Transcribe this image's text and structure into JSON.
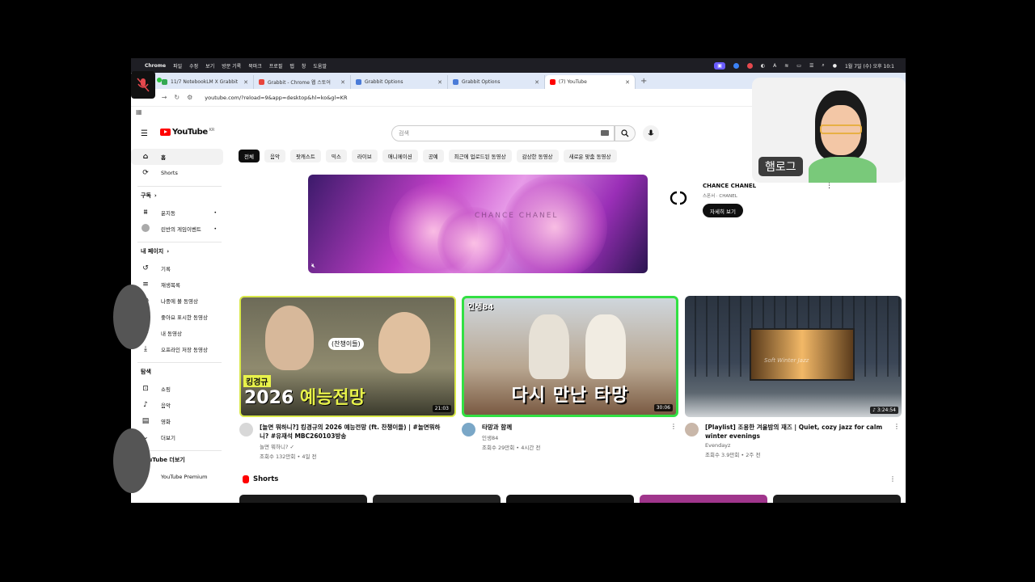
{
  "menubar": {
    "app": "Chrome",
    "items": [
      "파일",
      "수정",
      "보기",
      "방문 기록",
      "북마크",
      "프로필",
      "탭",
      "창",
      "도움말"
    ],
    "clock": "1월 7일 (수) 오후 10:1"
  },
  "tabs": [
    {
      "label": "11/7 NotebookLM X Grabbit",
      "color": "#34a853"
    },
    {
      "label": "Grabbit - Chrome 웹 스토어",
      "color": "#e8453c"
    },
    {
      "label": "Grabbit Options",
      "color": "#4a7bd8"
    },
    {
      "label": "Grabbit Options",
      "color": "#4a7bd8"
    },
    {
      "label": "(7) YouTube",
      "color": "#ff0000"
    }
  ],
  "address": {
    "url": "youtube.com/?reload=9&app=desktop&hl=ko&gl=KR"
  },
  "youtube": {
    "logo": "YouTube",
    "region": "KR",
    "search_placeholder": "검색"
  },
  "sidebar": {
    "main": [
      {
        "label": "홈",
        "icon": "home-icon",
        "active": true
      },
      {
        "label": "Shorts",
        "icon": "shorts-icon",
        "active": false
      }
    ],
    "subs_header": "구독",
    "subs": [
      {
        "label": "윤지동",
        "live": "•"
      },
      {
        "label": "린반의 게임이벤트",
        "live": "•"
      }
    ],
    "you_header": "내 페이지",
    "you": [
      {
        "label": "기록",
        "icon": "history-icon"
      },
      {
        "label": "재생목록",
        "icon": "playlist-icon"
      },
      {
        "label": "나중에 볼 동영상",
        "icon": "clock-icon"
      },
      {
        "label": "좋아요 표시한 동영상",
        "icon": "thumb-up-icon"
      },
      {
        "label": "내 동영상",
        "icon": "my-videos-icon"
      },
      {
        "label": "오프라인 저장 동영상",
        "icon": "download-icon"
      }
    ],
    "explore_header": "탐색",
    "explore": [
      {
        "label": "쇼핑",
        "icon": "shopping-bag-icon"
      },
      {
        "label": "음악",
        "icon": "music-icon"
      },
      {
        "label": "영화",
        "icon": "movie-icon"
      },
      {
        "label": "더보기",
        "icon": "chevron-down-icon"
      }
    ],
    "more_header": "YouTube 더보기",
    "more": [
      {
        "label": "YouTube Premium",
        "icon": "youtube-premium-icon"
      }
    ]
  },
  "chips": [
    "전체",
    "음악",
    "팟캐스트",
    "믹스",
    "라이브",
    "애니메이션",
    "공예",
    "최근에 업로드된 동영상",
    "감상한 동영상",
    "새로운 맞춤 동영상"
  ],
  "ad": {
    "watermark": "CHANCE CHANEL",
    "title": "CHANCE CHANEL",
    "sponsor": "스폰서 · CHANEL",
    "cta": "자세히 보기",
    "logo_glyph": "CC"
  },
  "videos": [
    {
      "title": "[놀면 뭐하니?] 킹경규의 2026 예능전망 (ft. 찬챙이들) | #놀면뭐하니? #유재석 MBC260103방송",
      "channel": "놀면 뭐하니?",
      "verified": "✓",
      "stats": "조회수 132만회 • 4일 전",
      "duration": "21:03",
      "thumb_tag": "킹경규",
      "thumb_caption_a": "2026 ",
      "thumb_caption_b": "예능전망",
      "thumb_bubble": "(찬챙이들)",
      "avatar_color": "#d8d8d8"
    },
    {
      "title": "타망과 함께",
      "channel": "인생84",
      "stats": "조회수 29만회 • 4시간 전",
      "duration": "30:06",
      "thumb_brand": "인생84",
      "thumb_caption": "다시 만난 타망",
      "avatar_color": "#7aa7c7"
    },
    {
      "title": "[Playlist] 조용한 겨울밤의 재즈 | Quiet, cozy jazz for calm winter evenings",
      "channel": "Evendayz",
      "stats": "조회수 3.9만회 • 2주 전",
      "duration": "3:24:54",
      "thumb_script": "Soft Winter Jazz",
      "avatar_color": "#c9b7a9"
    }
  ],
  "shorts": {
    "label": "Shorts"
  },
  "webcam": {
    "name_label": "햄로그"
  }
}
